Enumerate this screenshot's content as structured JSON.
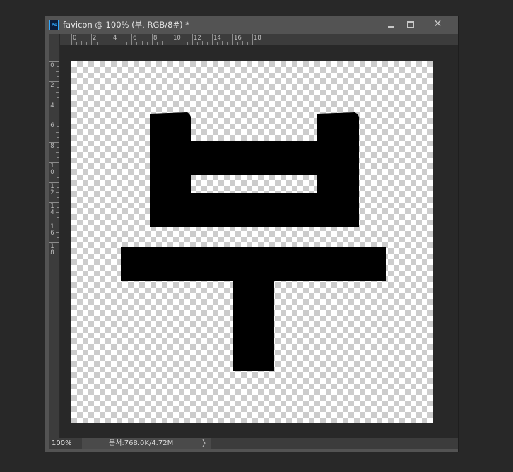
{
  "window": {
    "app_icon_label": "Ps",
    "title": "favicon @ 100% (부, RGB/8#) *",
    "minimize_icon": "minimize-icon",
    "maximize_icon": "maximize-icon",
    "close_icon": "close-icon",
    "close_glyph": "✕"
  },
  "ruler": {
    "horizontal_labels": [
      "0",
      "2",
      "4",
      "6",
      "8",
      "10",
      "12",
      "14",
      "16",
      "18"
    ],
    "vertical_labels": [
      "0",
      "2",
      "4",
      "6",
      "8",
      "10",
      "12",
      "14",
      "16",
      "18"
    ],
    "units": "px"
  },
  "canvas": {
    "background": "transparent-checkerboard",
    "checker_colors": [
      "#ffffff",
      "#cccccc"
    ],
    "glyph_color": "#000000",
    "glyph_character": "부"
  },
  "status": {
    "zoom": "100%",
    "doc_info": "문서:768.0K/4.72M",
    "arrow": "〉"
  },
  "colors": {
    "window_chrome": "#535353",
    "pasteboard": "#282828",
    "ps_icon_accent": "#31a8ff"
  }
}
